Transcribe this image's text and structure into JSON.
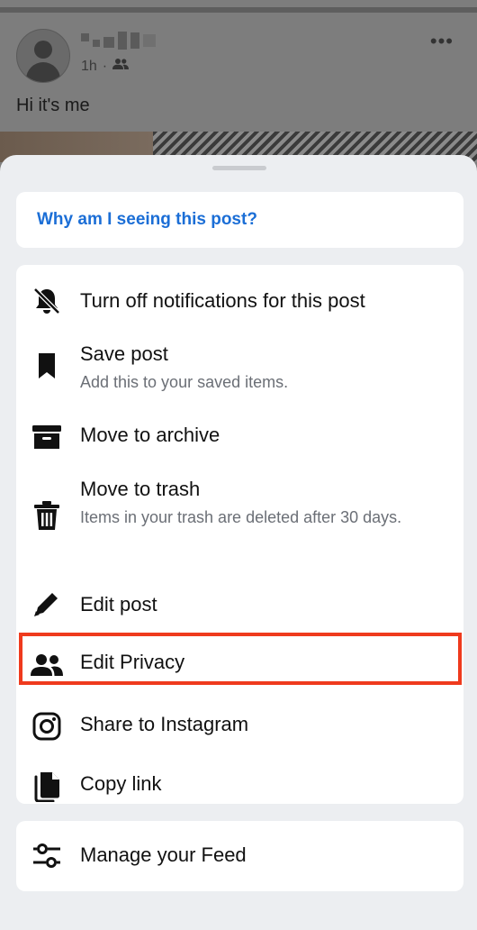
{
  "post": {
    "time": "1h",
    "audience_icon": "friends-icon",
    "text": "Hi it's me",
    "more_icon": "•••"
  },
  "sheet": {
    "why_link": "Why am I seeing this post?",
    "items": [
      {
        "icon": "bell-off-icon",
        "title": "Turn off notifications for this post"
      },
      {
        "icon": "bookmark-icon",
        "title": "Save post",
        "subtitle": "Add this to your saved items."
      },
      {
        "icon": "archive-icon",
        "title": "Move to archive"
      },
      {
        "icon": "trash-icon",
        "title": "Move to trash",
        "subtitle": "Items in your trash are deleted after 30 days."
      },
      {
        "icon": "pencil-icon",
        "title": "Edit post"
      },
      {
        "icon": "friends-icon",
        "title": "Edit Privacy",
        "highlighted": true
      },
      {
        "icon": "instagram-icon",
        "title": "Share to Instagram"
      },
      {
        "icon": "copy-link-icon",
        "title": "Copy link"
      }
    ],
    "feed": {
      "icon": "sliders-icon",
      "title": "Manage your Feed"
    }
  },
  "colors": {
    "link": "#1b6ed6",
    "highlight_border": "#ef3a1d",
    "sheet_bg": "#eceef1",
    "card_bg": "#ffffff"
  }
}
